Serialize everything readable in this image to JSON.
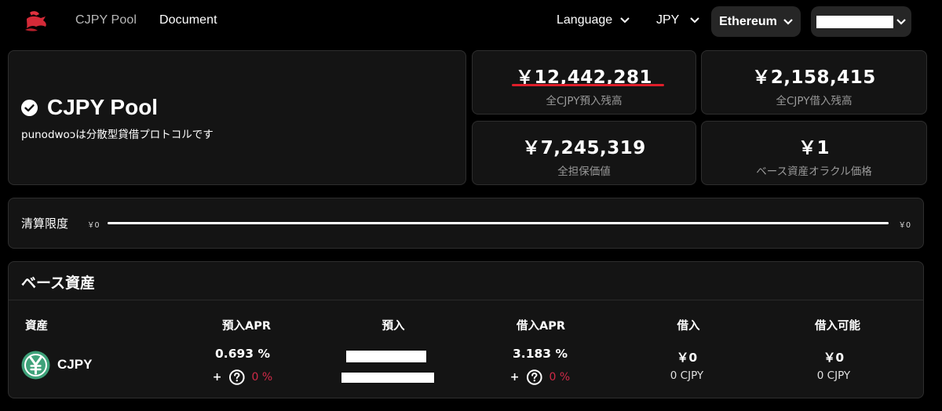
{
  "header": {
    "nav": [
      {
        "label": "CJPY Pool"
      },
      {
        "label": "Document"
      }
    ],
    "language_label": "Language",
    "currency_label": "JPY",
    "network_label": "Ethereum",
    "account_label": ""
  },
  "hero": {
    "title": "CJPY Pool",
    "subtitle": "punodwoɔは分散型貸借プロトコルです"
  },
  "stats": {
    "total_deposit": {
      "value": "￥12,442,281",
      "label": "全CJPY預入残高"
    },
    "total_borrow": {
      "value": "￥2,158,415",
      "label": "全CJPY借入残高"
    },
    "collateral": {
      "value": "￥7,245,319",
      "label": "全担保価値"
    },
    "oracle": {
      "value": "￥1",
      "label": "ベース資産オラクル価格"
    }
  },
  "liquidation": {
    "label": "清算限度",
    "min": "￥0",
    "max": "￥0"
  },
  "base_assets": {
    "title": "ベース資産",
    "columns": [
      "資産",
      "預入APR",
      "預入",
      "借入APR",
      "借入",
      "借入可能"
    ],
    "rows": [
      {
        "asset": "CJPY",
        "deposit_apr": "0.693 %",
        "deposit_bonus_plus": "+",
        "deposit_bonus_pct": "0 %",
        "borrow_apr": "3.183 %",
        "borrow_bonus_plus": "+",
        "borrow_bonus_pct": "0 %",
        "borrow_value": "￥0",
        "borrow_amount": "0 CJPY",
        "available_value": "￥0",
        "available_amount": "0 CJPY"
      }
    ]
  },
  "colors": {
    "background": "#000000",
    "card": "#141414",
    "accent_red": "#e01e2a",
    "bonus_pink": "#d02a48",
    "asset_green": "#3fa27a"
  },
  "icons": [
    "logo-icon",
    "chevron-down-icon",
    "check-circle-icon",
    "yen-coin-icon",
    "question-circle-icon"
  ]
}
